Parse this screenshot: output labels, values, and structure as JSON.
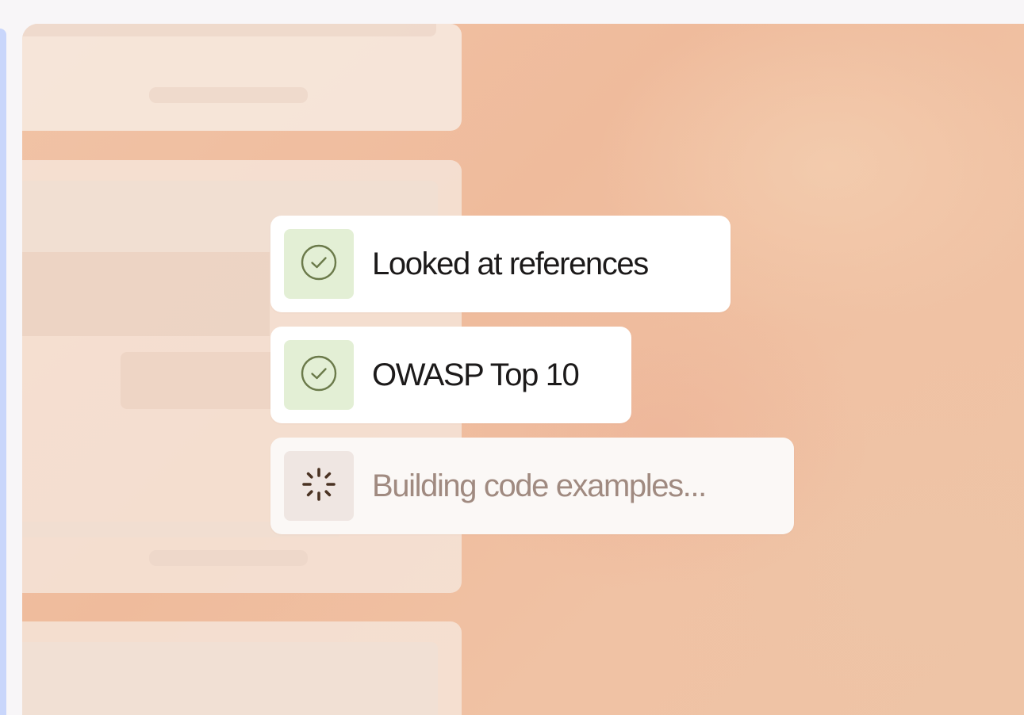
{
  "steps": [
    {
      "label": "Looked at references",
      "status": "done",
      "icon": "check-circle-icon"
    },
    {
      "label": "OWASP Top 10",
      "status": "done",
      "icon": "check-circle-icon"
    },
    {
      "label": "Building code examples...",
      "status": "in-progress",
      "icon": "spinner-icon"
    }
  ],
  "colors": {
    "done_badge": "#e3efd5",
    "done_icon": "#6b7a4a",
    "loading_badge": "#efe6e2",
    "loading_icon": "#4a3222",
    "loading_text": "#a08a80",
    "accent_strip": "#c9d6fb"
  }
}
